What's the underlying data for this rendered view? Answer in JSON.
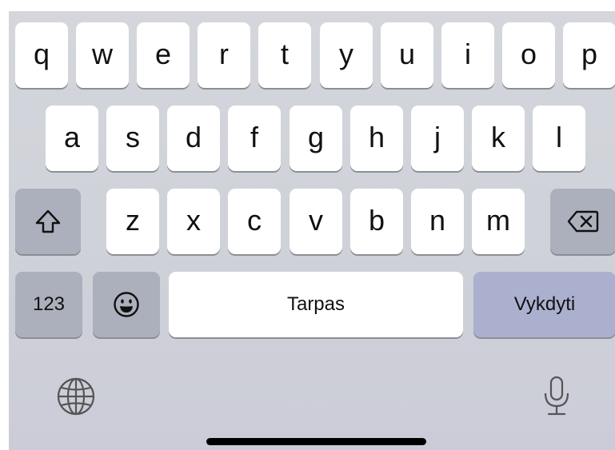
{
  "keyboard": {
    "row1": [
      "q",
      "w",
      "e",
      "r",
      "t",
      "y",
      "u",
      "i",
      "o",
      "p"
    ],
    "row2": [
      "a",
      "s",
      "d",
      "f",
      "g",
      "h",
      "j",
      "k",
      "l"
    ],
    "row3": [
      "z",
      "x",
      "c",
      "v",
      "b",
      "n",
      "m"
    ],
    "numbers_label": "123",
    "space_label": "Tarpas",
    "return_label": "Vykdyti",
    "icons": {
      "shift": "shift-arrow-icon",
      "delete": "backspace-icon",
      "emoji": "smiley-face-icon",
      "globe": "globe-icon",
      "mic": "microphone-icon"
    },
    "colors": {
      "background": "#cfd1d9",
      "letter_key": "#ffffff",
      "function_key": "#abb0bc",
      "return_key": "#acb0cf",
      "text": "#111111"
    }
  }
}
